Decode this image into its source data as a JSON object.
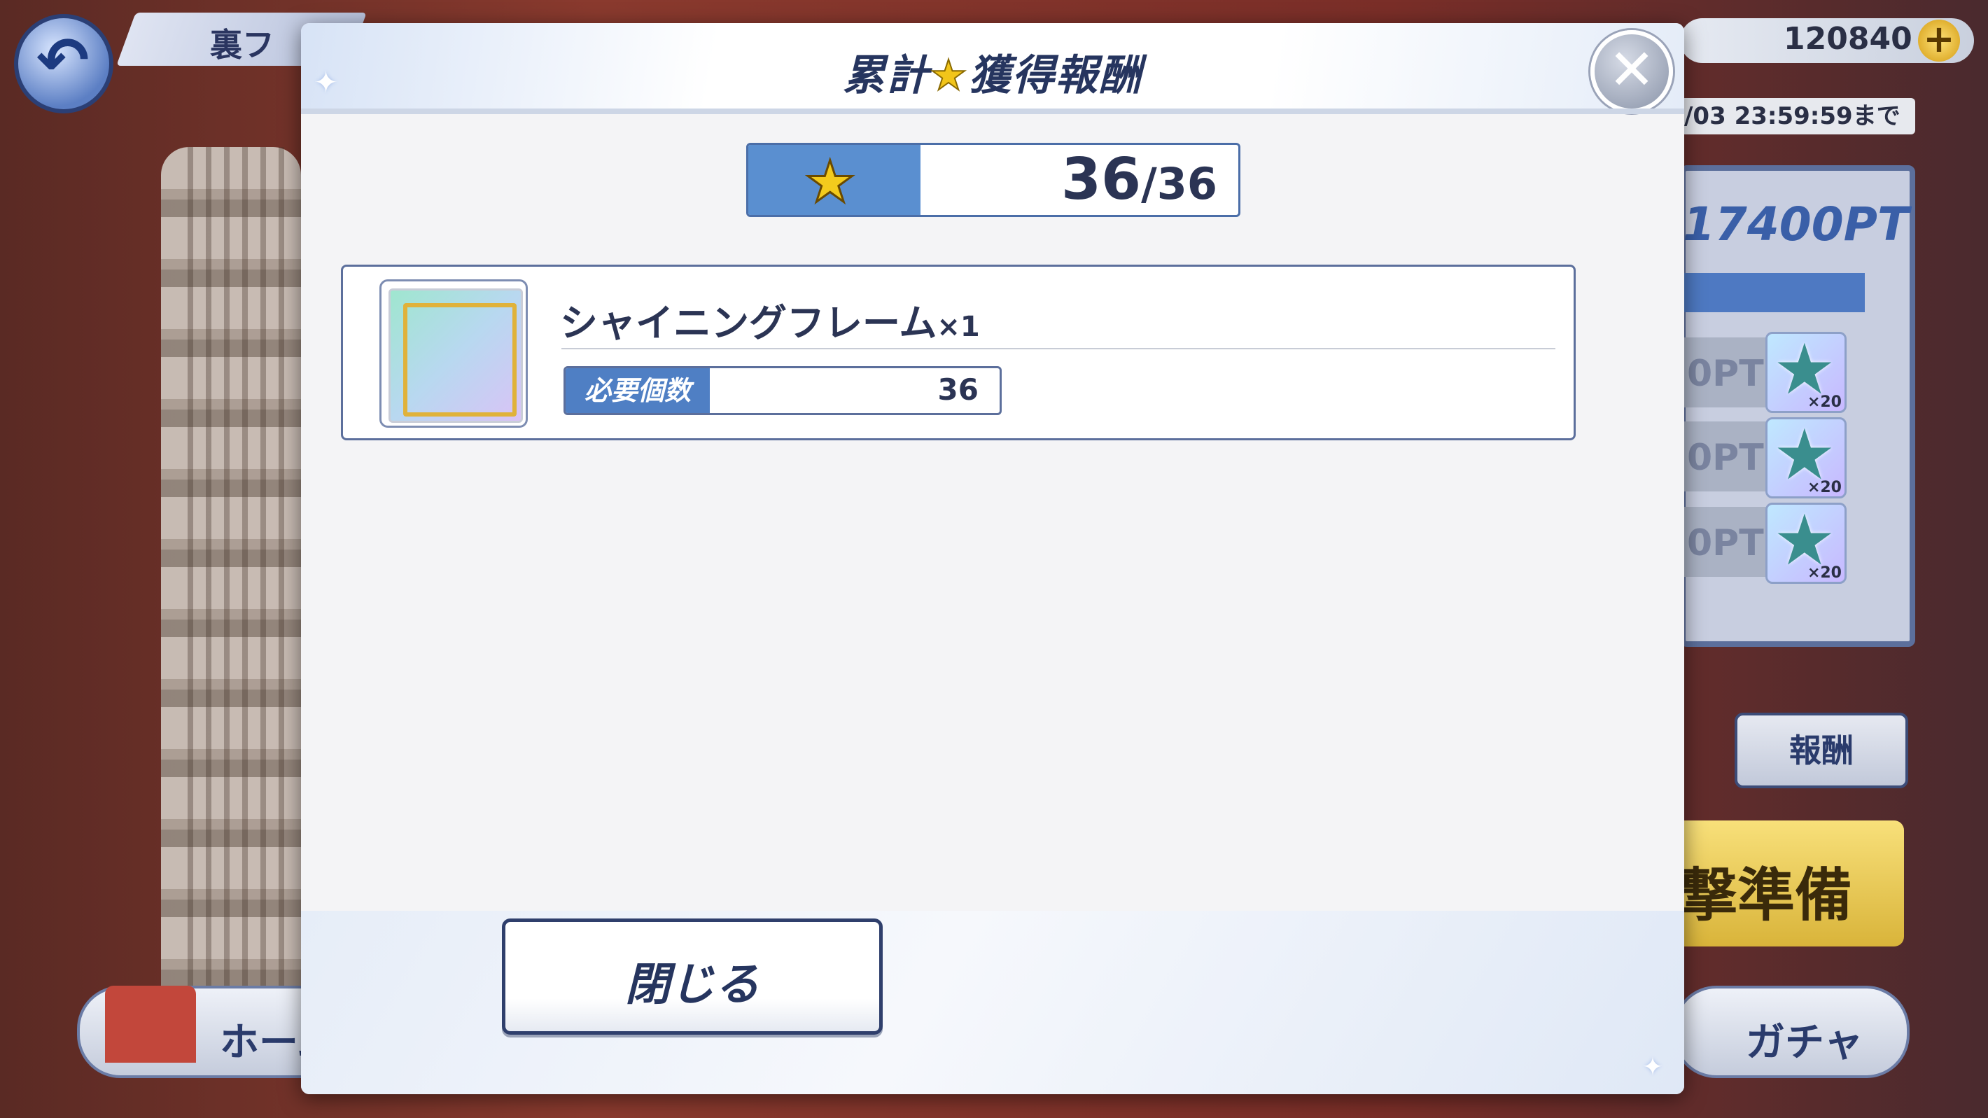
{
  "background": {
    "screen_title": "裏フ",
    "coins": "120840",
    "deadline": "/03 23:59:59まで",
    "points": "17400PT",
    "rows": [
      "0PT",
      "0PT",
      "0PT"
    ],
    "reward_button": "報酬",
    "prepare_button": "撃準備",
    "home_button": "ホーム",
    "gacha_button": "ガチャ"
  },
  "modal": {
    "title_left": "累計",
    "title_right": "獲得報酬",
    "star_counter": {
      "current": "36",
      "total": "/36"
    },
    "rewards": [
      {
        "name": "シャイニングフレーム",
        "quantity": "×1",
        "required_label": "必要個数",
        "required_value": "36"
      }
    ],
    "close_label": "閉じる"
  },
  "colors": {
    "accent": "#5a8fd0",
    "text_dark": "#26355f",
    "star": "#f2c51a"
  }
}
